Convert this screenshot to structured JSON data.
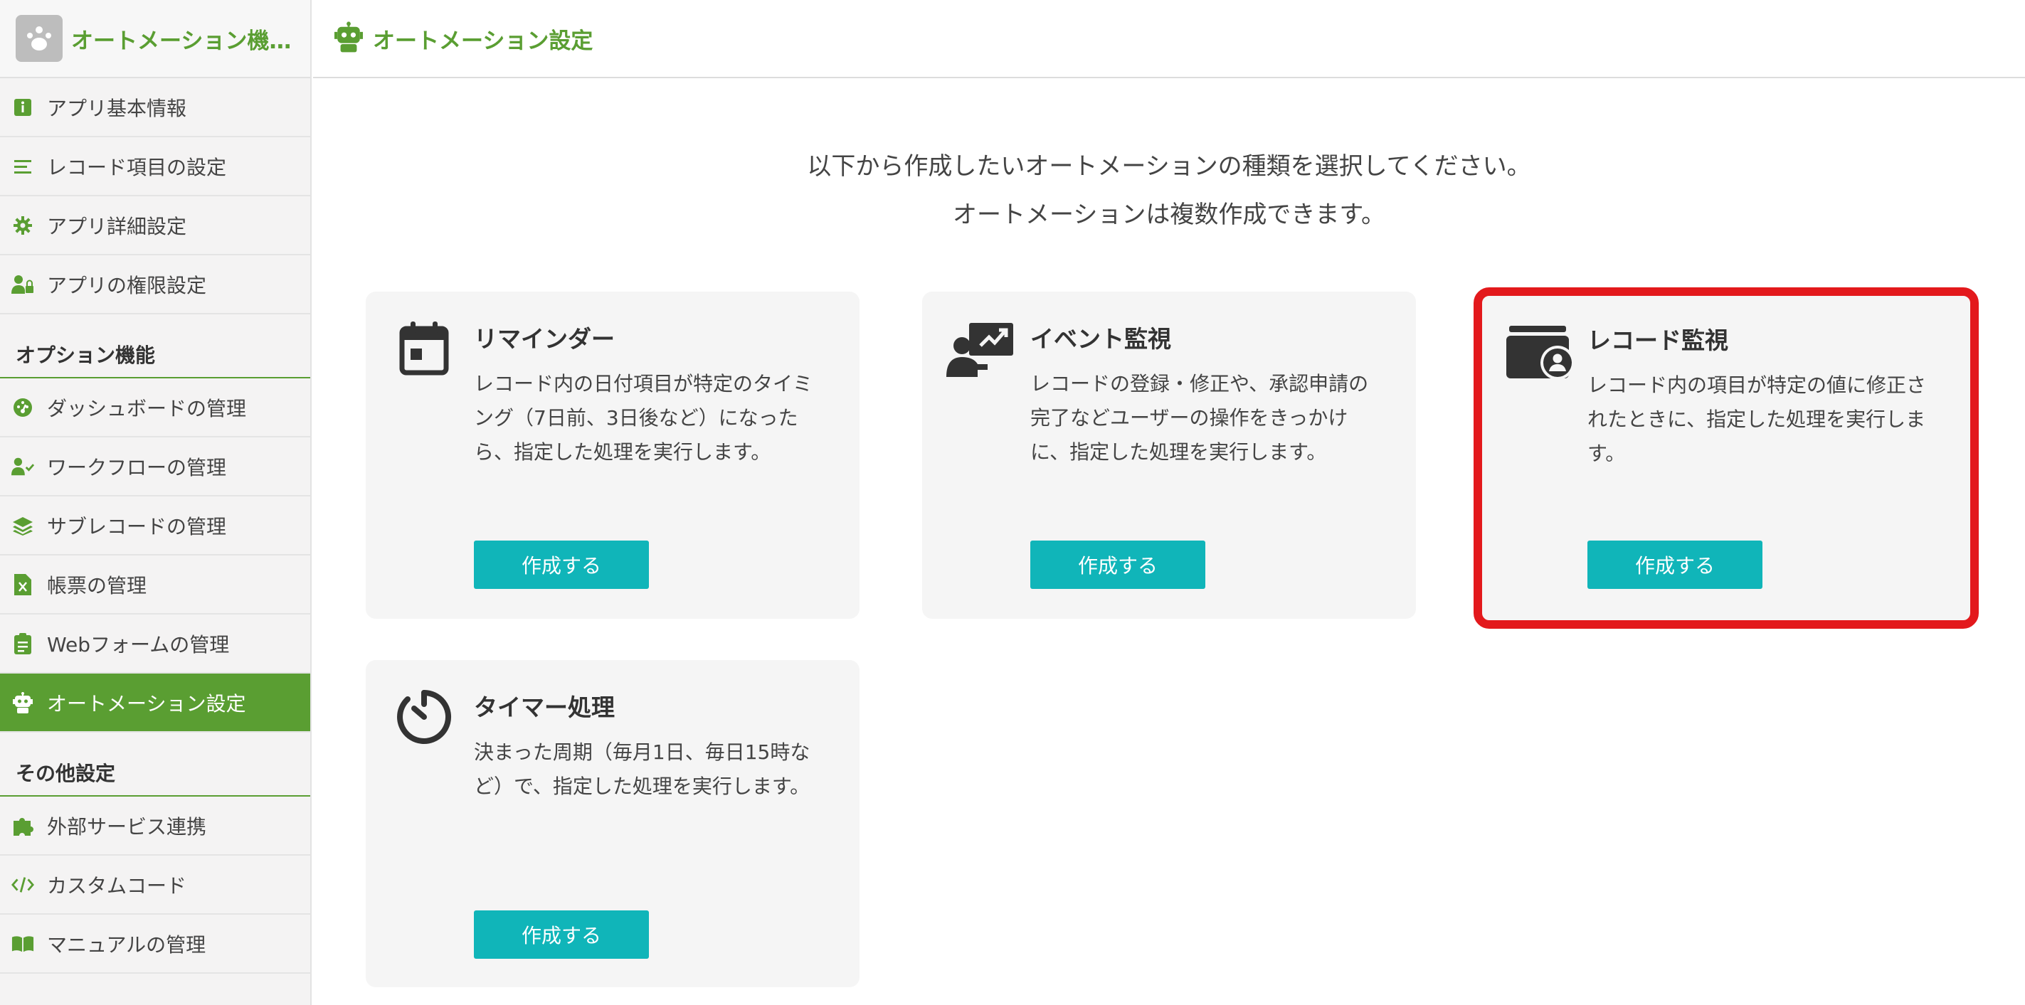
{
  "sidebar": {
    "app_title": "オートメーション機…",
    "items_top": [
      {
        "label": "アプリ基本情報",
        "icon": "info-icon"
      },
      {
        "label": "レコード項目の設定",
        "icon": "list-icon"
      },
      {
        "label": "アプリ詳細設定",
        "icon": "gear-icon"
      },
      {
        "label": "アプリの権限設定",
        "icon": "user-lock-icon"
      }
    ],
    "section_options": "オプション機能",
    "items_options": [
      {
        "label": "ダッシュボードの管理",
        "icon": "dashboard-icon"
      },
      {
        "label": "ワークフローの管理",
        "icon": "user-check-icon"
      },
      {
        "label": "サブレコードの管理",
        "icon": "layers-icon"
      },
      {
        "label": "帳票の管理",
        "icon": "excel-file-icon"
      },
      {
        "label": "Webフォームの管理",
        "icon": "clipboard-icon"
      },
      {
        "label": "オートメーション設定",
        "icon": "robot-icon"
      }
    ],
    "section_other": "その他設定",
    "items_other": [
      {
        "label": "外部サービス連携",
        "icon": "puzzle-icon"
      },
      {
        "label": "カスタムコード",
        "icon": "code-icon"
      },
      {
        "label": "マニュアルの管理",
        "icon": "book-icon"
      }
    ]
  },
  "header": {
    "title": "オートメーション設定"
  },
  "main": {
    "intro_line1": "以下から作成したいオートメーションの種類を選択してください。",
    "intro_line2": "オートメーションは複数作成できます。",
    "cards": [
      {
        "title": "リマインダー",
        "icon": "calendar-icon",
        "description": "レコード内の日付項目が特定のタイミング（7日前、3日後など）になったら、指定した処理を実行します。",
        "button": "作成する"
      },
      {
        "title": "イベント監視",
        "icon": "user-presentation-icon",
        "description": "レコードの登録・修正や、承認申請の完了などユーザーの操作をきっかけに、指定した処理を実行します。",
        "button": "作成する"
      },
      {
        "title": "レコード監視",
        "icon": "record-user-icon",
        "description": "レコード内の項目が特定の値に修正されたときに、指定した処理を実行します。",
        "button": "作成する"
      },
      {
        "title": "タイマー処理",
        "icon": "timer-icon",
        "description": "決まった周期（毎月1日、毎日15時など）で、指定した処理を実行します。",
        "button": "作成する"
      }
    ]
  },
  "colors": {
    "brand_green": "#5a9e32",
    "button_teal": "#10b5b9",
    "highlight_red": "#e3191c"
  }
}
